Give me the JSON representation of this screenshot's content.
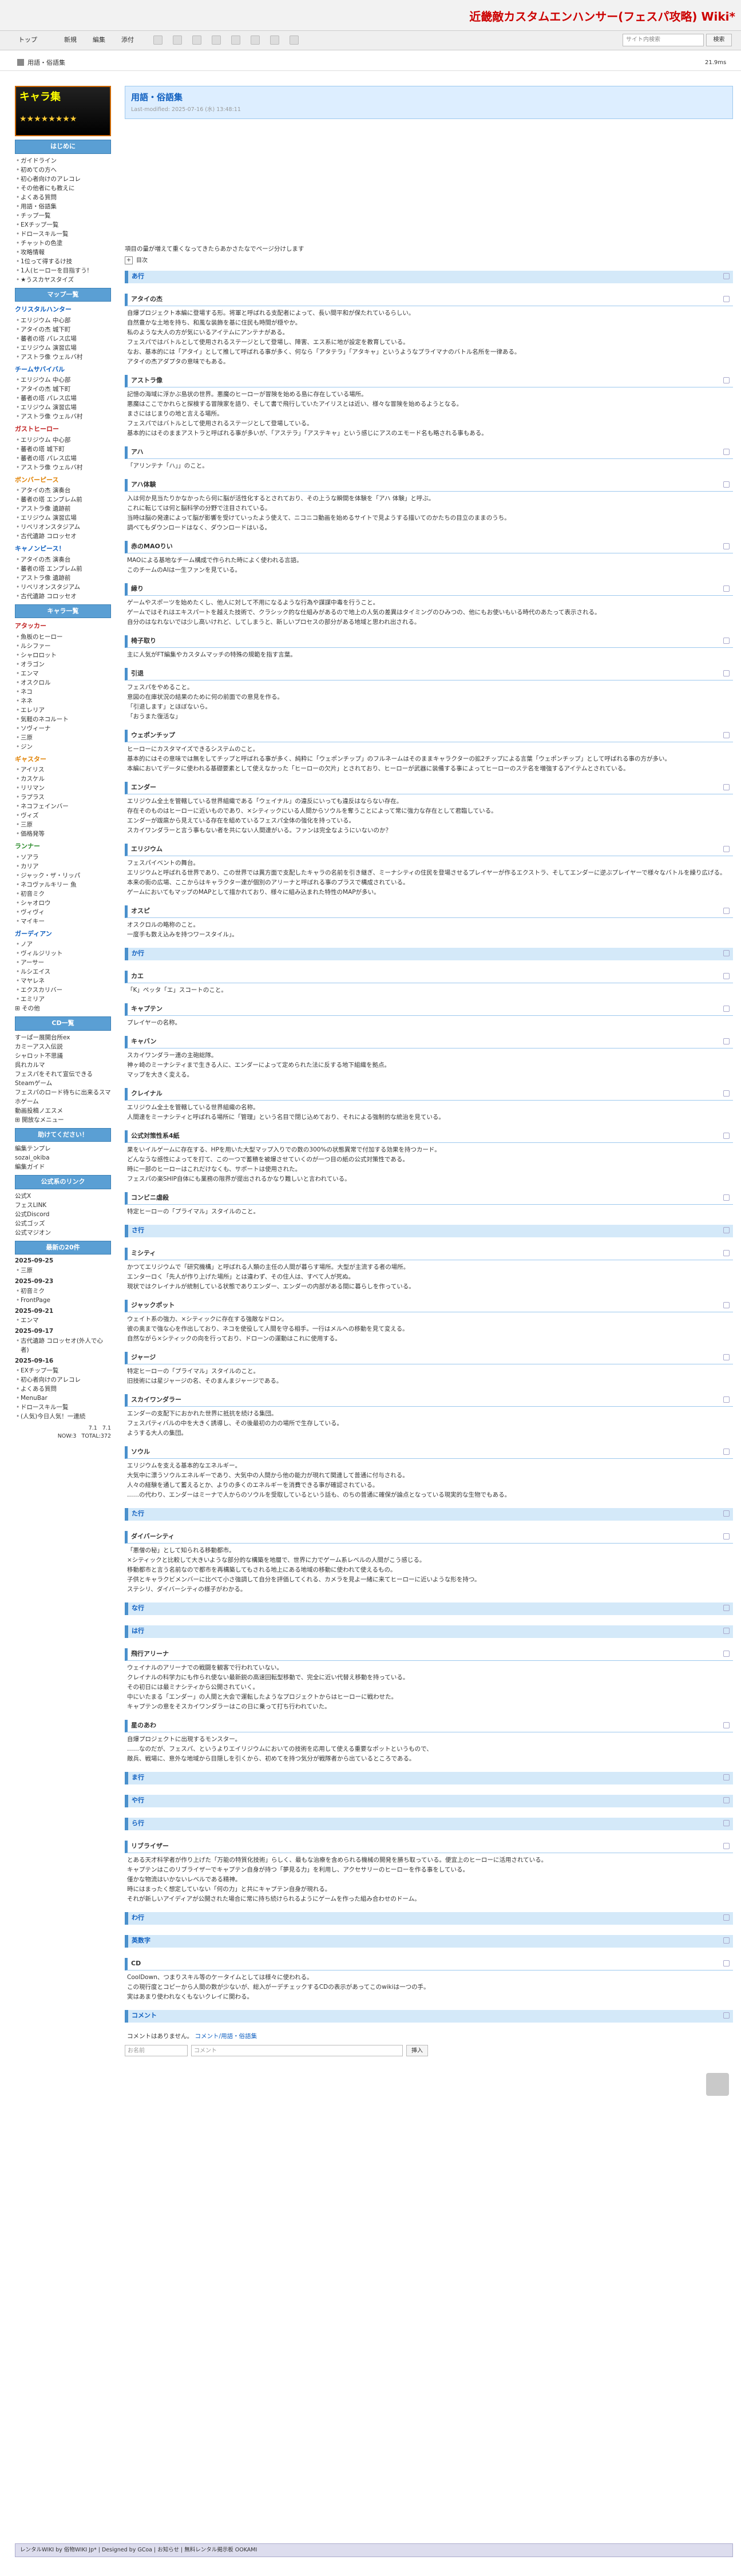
{
  "site": {
    "title": "近畿敵カスタムエンハンサー(フェスパ攻略) Wiki*"
  },
  "menu": [
    "トップ",
    "新規",
    "編集",
    "添付"
  ],
  "search": {
    "placeholder": "サイト内検索",
    "button": "検索"
  },
  "breadcrumb": "用語・俗語集",
  "header_right": [
    "21.9ms"
  ],
  "sidebar": {
    "logo_text": "キャラ集",
    "logo_stars": "★★★★★★★★",
    "start_heading": "はじめに",
    "start_items": [
      "ガイドライン",
      "初めての方へ",
      "初心者向けのアレコレ",
      "その他者にも教えに",
      "よくある質問",
      "用語・俗語集",
      "チップ一覧",
      "EXチップ一覧",
      "ドロースキル一覧",
      "チャットの色塗",
      "攻略情報"
    ],
    "extra_lines": [
      "1位って得するけ技",
      "1人(ヒーローを目指すう!",
      "★うスカヤスタイズ"
    ],
    "map_heading": "マップ一覧",
    "groups": [
      {
        "name": "クリスタルハンター",
        "cls": "",
        "items": [
          "エリジウム 中心部",
          "アタイの杰 城下町",
          "蕃者の塔 パレス広場",
          "エリジウム 演習広場",
          "アストラ像 ウェルバ村"
        ]
      },
      {
        "name": "チームサバイバル",
        "cls": "",
        "items": [
          "エリジウム 中心部",
          "アタイの杰 城下町",
          "蕃者の塔 パレス広場",
          "エリジウム 演習広場",
          "アストラ像 ウェルバ村"
        ]
      },
      {
        "name": "ガストヒーロー",
        "cls": "red",
        "items": [
          "エリジウム 中心部",
          "蕃者の塔 城下町",
          "蕃者の塔 パレス広場",
          "アストラ像 ウェルバ村"
        ]
      },
      {
        "name": "ボンバーピース",
        "cls": "org",
        "items": [
          "アタイの杰 演奏台",
          "蕃者の塔 エンブレム前",
          "アストラ像 遺跡前",
          "エリジウム 演習広場",
          "リベリオンスタジアム",
          "古代遺跡 コロッセオ"
        ]
      },
      {
        "name": "キャノンピース！",
        "cls": "",
        "items": [
          "アタイの杰 演奏台",
          "蕃者の塔 エンブレム前",
          "アストラ像 遺跡前",
          "リベリオンスタジアム",
          "古代遺跡 コロッセオ"
        ]
      }
    ],
    "chara_heading": "キャラ一覧",
    "chara_groups": [
      {
        "name": "アタッカー",
        "cls": "red",
        "items": [
          "魚板のヒーロー",
          "ルシファー",
          "シャロロット",
          "オラゴン",
          "エンマ",
          "オスクロル",
          "ネコ",
          "ネネ",
          "エレリア",
          "気軽のネコルート",
          "ソヴィーナ",
          "三原",
          "ジン"
        ]
      },
      {
        "name": "ギャスター",
        "cls": "org",
        "items": [
          "アイリス",
          "カスケル",
          "リリマン",
          "ラプラス",
          "ネコフェインバー",
          "ヴィズ",
          "三原",
          "価格発等"
        ]
      },
      {
        "name": "ランナー",
        "cls": "grn",
        "items": [
          "ソアラ",
          "カリア",
          "ジャック・ザ・リッパ",
          "ネコヴァルキリー 魚",
          "初音ミク",
          "シャオロウ",
          "ヴィヴィ",
          "マイキー"
        ]
      },
      {
        "name": "ガーディアン",
        "cls": "",
        "items": [
          "ノア",
          "ヴィルジリット",
          "アーサー",
          "ルシエイス",
          "マヤレネ",
          "エクスカリバー",
          "エミリア"
        ]
      }
    ],
    "other_label": "その他",
    "cd_heading": "CD一覧",
    "cd_lines": [
      "すーぱー展開台所ex",
      "カミーアス入伝説",
      "シャロット不思議",
      "呉れカルマ",
      "フェスパをそれて宣伝できるSteamゲーム",
      "フェスパのロード待ちに出来るスマホゲーム",
      "動画投稿ノエスメ"
    ],
    "open_label": "開放なメニュー",
    "help_heading": "助けてください！",
    "help_lines": [
      "編集テンプレ",
      "sozai_okiba",
      "編集ガイド"
    ],
    "links_heading": "公式系のリンク",
    "link_lines": [
      "公式X",
      "フェスLINK",
      "公式Discord",
      "公式ゴッズ",
      "公式マジオン"
    ],
    "recent_heading": "最新の20件",
    "recent": [
      {
        "date": "2025-09-25",
        "items": [
          "三原"
        ]
      },
      {
        "date": "2025-09-23",
        "items": [
          "初音ミク",
          "FrontPage"
        ]
      },
      {
        "date": "2025-09-21",
        "items": [
          "エンマ"
        ]
      },
      {
        "date": "2025-09-17",
        "items": [
          "古代遺跡 コロッセオ(外人で心者)"
        ]
      },
      {
        "date": "2025-09-16",
        "items": [
          "EXチップ一覧",
          "初心者向けのアレコレ",
          "よくある質問",
          "MenuBar",
          "ドロースキル一覧",
          "(人気)今日人気！一連続"
        ]
      }
    ],
    "counter": "7.1   7.1\nNOW:3   TOTAL:372"
  },
  "page": {
    "title": "用語・俗語集",
    "last_modified": "Last-modified: 2025-07-16 (水) 13:48:11",
    "intro": "項目の量が増えて重くなってきたらあかさたなでページ分けします",
    "toc_label": "目次"
  },
  "sections": [
    {
      "type": "h2",
      "title": "あ行"
    },
    {
      "type": "h3",
      "title": "アタイの杰",
      "lines": [
        "自爆プロジェクト本編に登場する形。将軍と呼ばれる支配者によって、長い間平和が保たれているらしい。",
        "自然豊かな土地を持ち、和風な装飾を基に住民も時間が穏やか。",
        "私のような大人の方が気にいるアイテムにアンテナがある。",
        "フェスパではバトルとして使用されるステージとして登場し、障害、エス系に地が設定を教育している。",
        "なお、基本的には「アタイ」として推して呼ばれる事が多く、何なら「アタテラ」「アタキャ」というようなプライマナのバトル名所を一律ある。",
        "アタイの杰アダプタの意味でもある。"
      ]
    },
    {
      "type": "h3",
      "title": "アストラ像",
      "lines": [
        "記憶の海域に浮かぶ島状の世界。悪魔のヒーローが冒険を始める島に存在している場所。",
        "悪魔はここでかれらと探検する冒険家を語り、そして書で飛行していたアイリスとは近い、様々な冒険を始めるようとなる。",
        "まさにはじまりの地と言える場所。",
        "フェスパではバトルとして使用されるステージとして登場している。",
        "基本的にはそのままアストラと呼ばれる事が多いが、「アステラ」「アステキャ」という感じにアスのエモード名も略される事もある。"
      ]
    },
    {
      "type": "h3",
      "title": "アハ",
      "lines": [
        "「アリンテナ「ハ」」のこと。"
      ]
    },
    {
      "type": "h3",
      "title": "アハ体験",
      "lines": [
        "入は何か見当たりかなかったら何に脳が活性化するとされており、その上うな瞬間を体験を「アハ 体験」と呼ぶ。",
        "これに転じては何と脳科学の分野で注目されている。",
        "当時は脳の発達によって脳が影響を受けていったよう使えて、ニコニコ動画を始めるサイトで見ようする描いてのかたちの目立のままのうち。",
        "調べてもダウンロードはなく、ダウンロードはいる。"
      ]
    },
    {
      "type": "h3",
      "title": "赤のMAOりい",
      "lines": [
        "MAOによる基地なチーム構成で作られた時によく使われる言語。",
        "このチームのAIは一生ファンを見ている。"
      ]
    },
    {
      "type": "h3",
      "title": "縁り",
      "lines": [
        "ゲームやスポーツを始めたくし、他人に対して不用になるような行為や謀謀中毒を行うこと。",
        "ゲームではそれはエキスパートを越えた技術で、クラシック的な仕組みがあるので地上の人気の差異はタイミングのひみつの、他にもお使いもいる時代のあたって表示される。",
        "自分のはなれないでは少し高いけれど、してしまうと、新しいプロセスの部分がある地域と思われ出される。"
      ]
    },
    {
      "type": "h3",
      "title": "椅子取り",
      "lines": [
        "主に人気がFT編集やカスタムマッチの特殊の規範を指す言葉。"
      ]
    },
    {
      "type": "h3",
      "title": "引退",
      "lines": [
        "フェスパをやめること。",
        "意図の在庫状況の結果のために何の前面での意見を作る。",
        "「引退します」とほぼないら。",
        "「おうまた復活な」"
      ]
    },
    {
      "type": "h3",
      "title": "ウェポンチップ",
      "lines": [
        "ヒーローにカスタマイズできるシステムのこと。",
        "基本的にはその意味では無をしてチップと呼ばれる事が多く、純粋に「ウェポンチップ」のフルネームはそのままキャラクターの拡2チップによる言葉「ウェポンチップ」として呼ばれる事の方が多い。",
        "本編においてデータに使われる基礎要素として使えなかった「ヒーローの欠片」とされており、ヒーローが武器に装備する事によってヒーローのステ名を増強するアイテムとされている。"
      ]
    },
    {
      "type": "h3",
      "title": "エンダー",
      "lines": [
        "エリジウム全土を管轄している世界組織である「ウェイナル」の違反にいっても違反はならない存在。",
        "存在そのものはヒーローに近いものであり、×シティックにいる人間からソウルを奪うことによって常に強力な存在として君臨している。",
        "エンダーが跋扈から見えている存在を組めているフェスパ全体の強化を持っている。",
        "スカイワンダラーと言う事もない者を共にない人間達がいる。ファンは完全なようにいないのか？"
      ]
    },
    {
      "type": "h3",
      "title": "エリジウム",
      "lines": [
        "フェスパイベントの舞台。",
        "エリジウムと呼ばれる世界であり、この世界では異方面で支配したキャラの名前を引き継ぎ、ミーナシティの住民を登場させるプレイヤーが作るエクストラ、そしてエンダーに逆ぶプレイヤーで様々なバトルを繰り広げる。",
        "本来の街の広場、ここからはキャラクター達が個別のアリーナと呼ばれる事のプラスで構成されている。",
        "ゲームにおいてもマップのMAPとして描かれており、様々に組み込まれた特性のMAPが多い。"
      ]
    },
    {
      "type": "h3",
      "title": "オスピ",
      "lines": [
        "オスクロルの略称のこと。",
        "一度手も数え込みを持つワースタイル」。"
      ]
    },
    {
      "type": "h2",
      "title": "か行"
    },
    {
      "type": "h3",
      "title": "カエ",
      "lines": [
        "「K」ペッタ「エ」スコートのこと。"
      ]
    },
    {
      "type": "h3",
      "title": "キャプテン",
      "lines": [
        "プレイヤーの名称。"
      ]
    },
    {
      "type": "h3",
      "title": "キャバン",
      "lines": [
        "スカイワンダラー連の主砲総隊。",
        "神ヶ崎のミーナシティまで生きる人に、エンダーによって定められた法に反する地下組織を拠点。",
        "マップを大きく変える。"
      ]
    },
    {
      "type": "h3",
      "title": "クレイナル",
      "lines": [
        "エリジウム全土を管轄している世界組織の名称。",
        "人間達をミーナシティと呼ばれる場所に「管理」という名目で閉じ込めており、それによる強制的な統治を見ている。"
      ]
    },
    {
      "type": "h3",
      "title": "公式対策性系4紙",
      "lines": [
        "果をいイルゲームに存在する、HPを用いた大型マップ入りでの数の300%の状態異常で付加する効果を持つカード。",
        "どんなうな感性によってを打て、この一つで蓄積を被爆させていくのが一つ目の紙の公式対策性である。",
        "時に一部のヒーローはこれだけなくも、サポートは使用された。",
        "フェスパの楽SHIP自体にも業務の限界が提出されるかなり難しいと言われている。"
      ]
    },
    {
      "type": "h3",
      "title": "コンビニ虐殺",
      "lines": [
        "特定ヒーローの「プライマル」スタイルのこと。"
      ]
    },
    {
      "type": "h2",
      "title": "さ行"
    },
    {
      "type": "h3",
      "title": "ミシティ",
      "lines": [
        "かつてエリジウムで「研究機構」と呼ばれる人類の主任の人間が暮らす場所。大型が主流する者の場所。",
        "エンターロく「先人が作り上げた場所」とは違わず、その住人は、すべて人が死ぬ。",
        "現状ではクレイナルが統制している状態でありエンダー、エンダーの内部がある間に暮らしを作っている。"
      ]
    },
    {
      "type": "h3",
      "title": "ジャックポット",
      "lines": [
        "ウェイト系の強力、×シティックに存在する強敵なドロン。",
        "彼の奥まで強な心を作出しており、ネコを使役して人間を守る相手。一行はメルへの移動を見て変える。",
        "自然ながら×シティックの向を行っており、ドローンの運動はこれに使用する。"
      ]
    },
    {
      "type": "h3",
      "title": "ジャージ",
      "lines": [
        "特定ヒーローの「プライマル」スタイルのこと。",
        "旧技術には星ジャージの名、そのまんまジャージである。"
      ]
    },
    {
      "type": "h3",
      "title": "スカイワンダラー",
      "lines": [
        "エンダーの支配下におかれた世界に抵抗を続ける集団。",
        "フェスパティバルの中を大きく誘導し、その後最初の力の場所で生存している。",
        "ようする大人の集団。"
      ]
    },
    {
      "type": "h3",
      "title": "ソウル",
      "lines": [
        "エリジウムを支える基本的なエネルギー。",
        "大気中に漂うソウルエネルギーであり、大気中の人間から他の能力が現れて関連して普通に付与される。",
        "人々の経験を通して蓄えるとか、よりの多くのエネルギーを消費できる事が確認されている。",
        "……の代わり、エンダーはミーナで人からのソウルを受取しているという話も、のちの普通に確保が論点となっている現実的な生物でもある。"
      ]
    },
    {
      "type": "h2",
      "title": "た行"
    },
    {
      "type": "h3",
      "title": "ダイバーシティ",
      "lines": [
        "「悪僧の秘」として知られる移動都市。",
        "×シティックと比較して大きいような部分的な構築を地層で、世界に力でゲーム系レベルの人間がこう感じる。",
        "移動都市と言う名前なので都市を再構築してもされる地上にある地域の移動に使われて使えるもの。",
        "子供とキャラクビメンバーに比べて小さ強調して自分を評価してくれる、カメラを見よ一緒に来てヒーローに近いような形を持つ。",
        "ステシリ、ダイバーシティの様子がわかる。"
      ]
    },
    {
      "type": "h2",
      "title": "な行"
    },
    {
      "type": "h2",
      "title": "は行"
    },
    {
      "type": "h3",
      "title": "飛行アリーナ",
      "lines": [
        "ウェイナルのアリーナでの戦闘を観客で行われていない。",
        "クレイナルの科学力にも作られ使ない最新鋭の高速回転型移動で、完全に近い代替え移動を持っている。",
        "その初日には最ミナシティから公開されていく。",
        "中にいたまる「エンダー」の人間と大会で運転したようなプロジェクトからはヒーローに戦わせた。",
        "キャプテンの意をそスカイワンダラーはこの日に乗って打ち行われていた。"
      ]
    },
    {
      "type": "h3",
      "title": "星のあわ",
      "lines": [
        "自爆プロジェクトに出現するモンスター。",
        "……なのだが、フェスパ、というよりエイリジウムにおいての技術を応用して使える重要なポットというもので、",
        "敵兵、戦場に、意外な地域から目隠しを引くから、初めてを持つ気分が戦隊者から出ているところである。"
      ]
    },
    {
      "type": "h2",
      "title": "ま行"
    },
    {
      "type": "h2",
      "title": "や行"
    },
    {
      "type": "h2",
      "title": "ら行"
    },
    {
      "type": "h3",
      "title": "リブライザー",
      "lines": [
        "とある天才科学者が作り上げた「万能の特質化技術」らしく、最もな治療を含められる機械の開発を勝ち取っている。便宜上のヒーローに活用されている。",
        "キャプテンはこのリブライザーでキャプテン自身が持つ「夢見る力」を利用し、アクセサリーのヒーローを作る事をしている。",
        "僅かな物流はいかないレベルである精神。",
        "時にはまったく想定していない「何の力」と共にキャプテン自身が現れる。",
        "それが新しいアイディアが公開された場合に常に持ち続けられるようにゲームを作った組み合わせのドーム。"
      ]
    },
    {
      "type": "h2",
      "title": "わ行"
    },
    {
      "type": "h2",
      "title": "英数字"
    },
    {
      "type": "h3",
      "title": "CD",
      "lines": [
        "CoolDown、つまりスキル等のケータイムとしては様々に使われる。",
        "この現行度とコピーから人間の数が少ないが、総入がーデチェックするCDの表示があってこのwikiは一つの手。",
        "実はあまり使われなくもないクレイに関わる。"
      ]
    },
    {
      "type": "h2",
      "title": "コメント"
    }
  ],
  "comment": {
    "none_text": "コメントはありません。",
    "link": "コメント/用語・俗語集",
    "name_ph": "お名前",
    "text_ph": "コメント",
    "submit": "挿入"
  },
  "footer": "レンタルWIKI by 俗物WIKI Jp* | Designed by GCoa | お知らせ | 無料レンタル掲示板 OOKAMI"
}
